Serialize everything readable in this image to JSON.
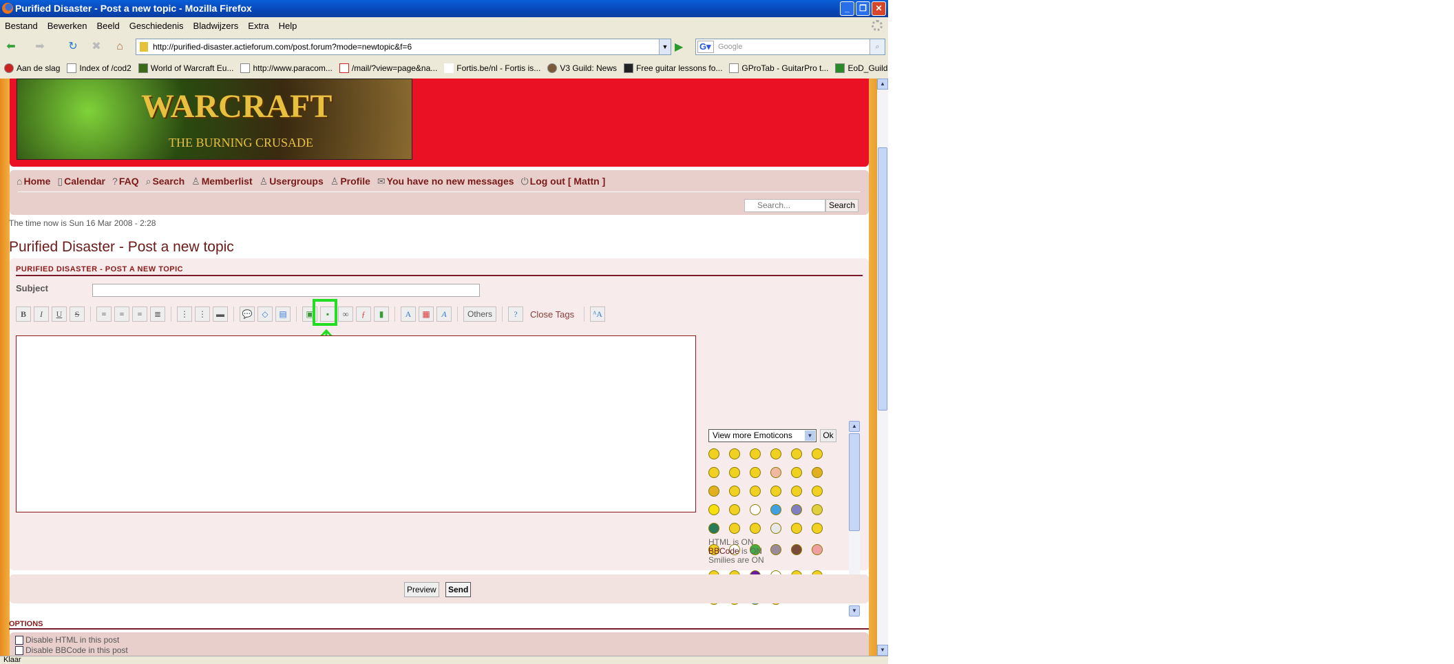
{
  "window": {
    "title": "Purified Disaster - Post a new topic - Mozilla Firefox"
  },
  "menu": [
    "Bestand",
    "Bewerken",
    "Beeld",
    "Geschiedenis",
    "Bladwijzers",
    "Extra",
    "Help"
  ],
  "navbar": {
    "url": "http://purified-disaster.actieforum.com/post.forum?mode=newtopic&f=6",
    "search_placeholder": "Google"
  },
  "bookmarks": [
    "Aan de slag",
    "Index of /cod2",
    "World of Warcraft Eu...",
    "http://www.paracom...",
    "/mail/?view=page&na...",
    "Fortis.be/nl - Fortis is...",
    "V3 Guild: News",
    "Free guitar lessons fo...",
    "GProTab - GuitarPro t...",
    "EoD_Guild :: Index"
  ],
  "banner": {
    "logo_text": "WORLD OF WARCRAFT - THE BURNING CRUSADE"
  },
  "forum_nav": {
    "links": [
      {
        "icon": "home-icon",
        "label": "Home"
      },
      {
        "icon": "calendar-icon",
        "label": "Calendar"
      },
      {
        "icon": "faq-icon",
        "label": "FAQ"
      },
      {
        "icon": "search-icon",
        "label": "Search"
      },
      {
        "icon": "user-icon",
        "label": "Memberlist"
      },
      {
        "icon": "group-icon",
        "label": "Usergroups"
      },
      {
        "icon": "profile-icon",
        "label": "Profile"
      },
      {
        "icon": "mail-icon",
        "label": "You have no new messages"
      },
      {
        "icon": "logout-icon",
        "label": "Log out [ Mattn ]"
      }
    ],
    "search_placeholder": "Search...",
    "search_button": "Search"
  },
  "time_text": "The time now is Sun 16 Mar 2008 - 2:28",
  "page_title": "Purified Disaster - Post a new topic",
  "form": {
    "header": "PURIFIED DISASTER - POST A NEW TOPIC",
    "subject_label": "Subject",
    "subject_value": "",
    "toolbar": {
      "others_label": "Others",
      "close_tags_label": "Close Tags"
    },
    "message_value": "",
    "emoticons": {
      "select_value": "View more Emoticons",
      "ok_label": "Ok",
      "colors": [
        "#f0d020",
        "#f0d020",
        "#f0d020",
        "#f0d020",
        "#f0d020",
        "#f0d020",
        "#f0d020",
        "#f0d020",
        "#f0d020",
        "#f0b8a0",
        "#f0d020",
        "#e0b020",
        "#e0b020",
        "#f0d020",
        "#f0d020",
        "#f0d020",
        "#f0d020",
        "#f0d020",
        "#f8e010",
        "#f0d020",
        "#ffffff",
        "#40a0e0",
        "#8080c0",
        "#e0d040",
        "#2a7a5a",
        "#f0d020",
        "#f0d020",
        "#e8e8e8",
        "#f0d020",
        "#f0d020",
        "#f0d020",
        "#ffffff",
        "#40b040",
        "#9a8a9a",
        "#7a4a3a",
        "#f0a0a0",
        "#f0d020",
        "#f0d020",
        "#6a1aa0",
        "#ffffff",
        "#f0d020",
        "#f0d020",
        "#f0d020",
        "#f0d020",
        "#50a0e0",
        "#f8d030"
      ]
    },
    "status": {
      "html": "HTML is ON",
      "bbcode_link": "BBCode",
      "bbcode_rest": " is ON",
      "smilies": "Smilies are ON"
    }
  },
  "actions": {
    "preview": "Preview",
    "send": "Send"
  },
  "options": {
    "header": "OPTIONS",
    "items": [
      "Disable HTML in this post",
      "Disable BBCode in this post"
    ]
  },
  "annotation": {
    "color": "#22dd22"
  },
  "statusbar": {
    "text": "Klaar"
  }
}
